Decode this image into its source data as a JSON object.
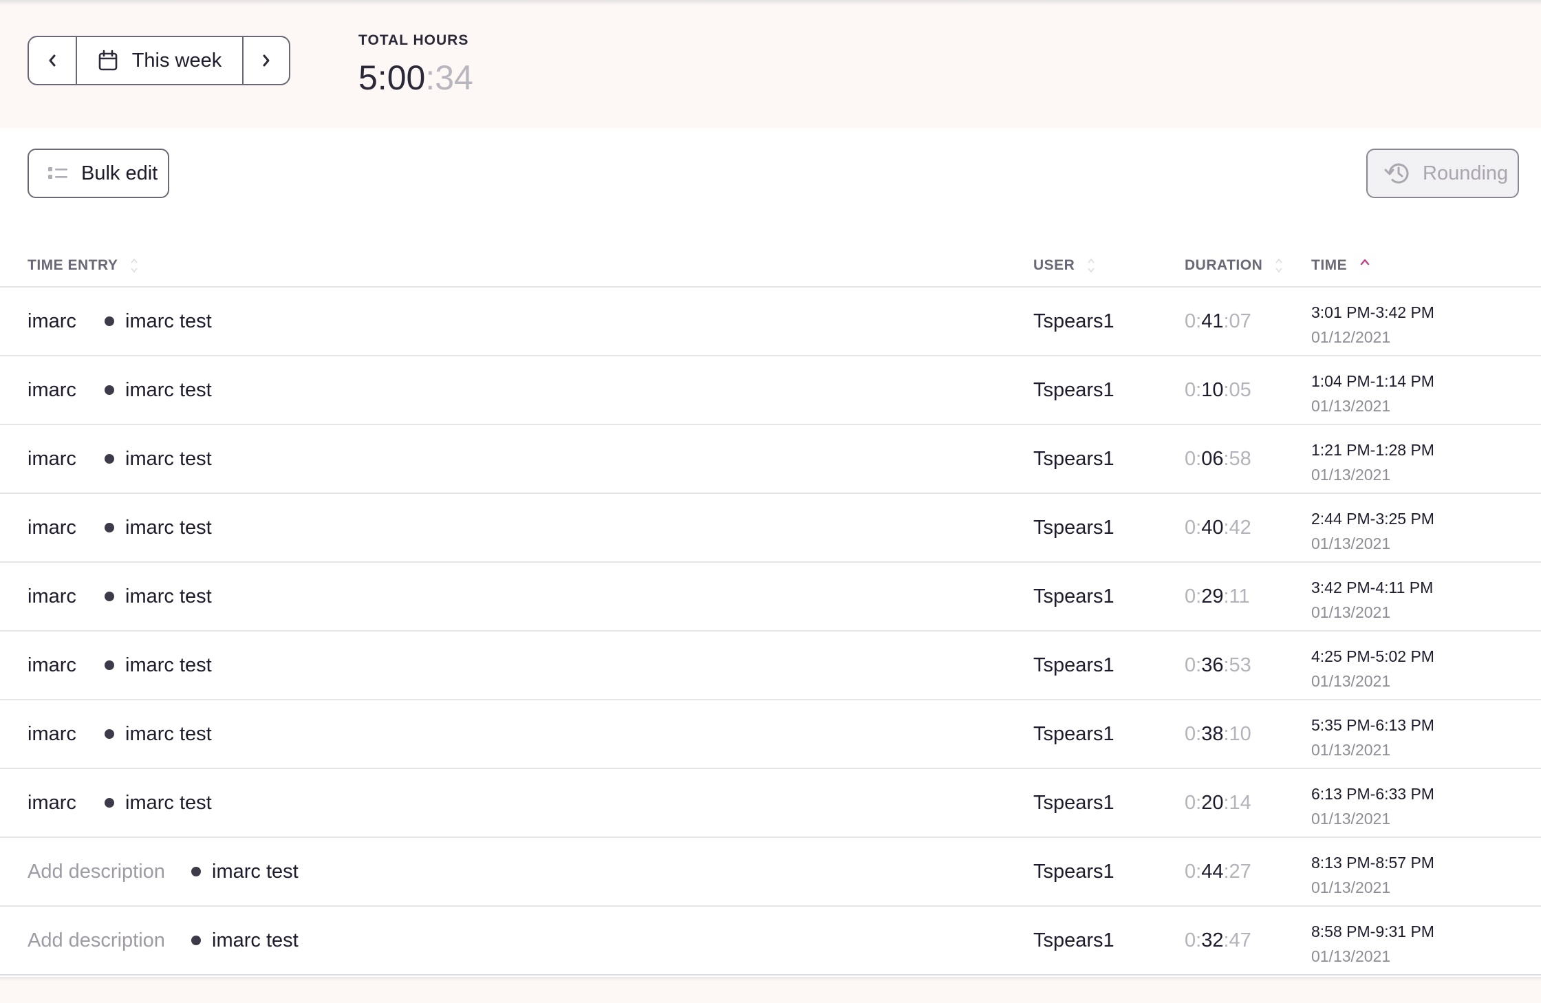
{
  "header": {
    "week_label": "This week",
    "total_label": "TOTAL HOURS",
    "total_main": "5:00",
    "total_sec": ":34"
  },
  "toolbar": {
    "bulk_edit_label": "Bulk edit",
    "rounding_label": "Rounding"
  },
  "table": {
    "columns": {
      "entry": "TIME ENTRY",
      "user": "USER",
      "duration": "DURATION",
      "time": "TIME"
    },
    "rows": [
      {
        "description": "imarc",
        "project": "imarc test",
        "user": "Tspears1",
        "dur_h": "0:",
        "dur_m": "41",
        "dur_s": ":07",
        "range": "3:01 PM-3:42 PM",
        "date": "01/12/2021"
      },
      {
        "description": "imarc",
        "project": "imarc test",
        "user": "Tspears1",
        "dur_h": "0:",
        "dur_m": "10",
        "dur_s": ":05",
        "range": "1:04 PM-1:14 PM",
        "date": "01/13/2021"
      },
      {
        "description": "imarc",
        "project": "imarc test",
        "user": "Tspears1",
        "dur_h": "0:",
        "dur_m": "06",
        "dur_s": ":58",
        "range": "1:21 PM-1:28 PM",
        "date": "01/13/2021"
      },
      {
        "description": "imarc",
        "project": "imarc test",
        "user": "Tspears1",
        "dur_h": "0:",
        "dur_m": "40",
        "dur_s": ":42",
        "range": "2:44 PM-3:25 PM",
        "date": "01/13/2021"
      },
      {
        "description": "imarc",
        "project": "imarc test",
        "user": "Tspears1",
        "dur_h": "0:",
        "dur_m": "29",
        "dur_s": ":11",
        "range": "3:42 PM-4:11 PM",
        "date": "01/13/2021"
      },
      {
        "description": "imarc",
        "project": "imarc test",
        "user": "Tspears1",
        "dur_h": "0:",
        "dur_m": "36",
        "dur_s": ":53",
        "range": "4:25 PM-5:02 PM",
        "date": "01/13/2021"
      },
      {
        "description": "imarc",
        "project": "imarc test",
        "user": "Tspears1",
        "dur_h": "0:",
        "dur_m": "38",
        "dur_s": ":10",
        "range": "5:35 PM-6:13 PM",
        "date": "01/13/2021"
      },
      {
        "description": "imarc",
        "project": "imarc test",
        "user": "Tspears1",
        "dur_h": "0:",
        "dur_m": "20",
        "dur_s": ":14",
        "range": "6:13 PM-6:33 PM",
        "date": "01/13/2021"
      },
      {
        "description": "Add description",
        "project": "imarc test",
        "user": "Tspears1",
        "dur_h": "0:",
        "dur_m": "44",
        "dur_s": ":27",
        "range": "8:13 PM-8:57 PM",
        "date": "01/13/2021",
        "placeholder": true
      },
      {
        "description": "Add description",
        "project": "imarc test",
        "user": "Tspears1",
        "dur_h": "0:",
        "dur_m": "32",
        "dur_s": ":47",
        "range": "8:58 PM-9:31 PM",
        "date": "01/13/2021",
        "placeholder": true
      }
    ]
  },
  "colors": {
    "header_bg": "#fdf8f6",
    "accent_sort": "#c2418f",
    "text": "#1f1b2d",
    "muted": "#9e9ba5"
  },
  "icons": {
    "prev": "chevron-left-icon",
    "next": "chevron-right-icon",
    "calendar": "calendar-icon",
    "bulk": "list-icon",
    "rounding": "history-icon",
    "sort": "sort-icon",
    "sort_asc": "chevron-up-icon"
  }
}
